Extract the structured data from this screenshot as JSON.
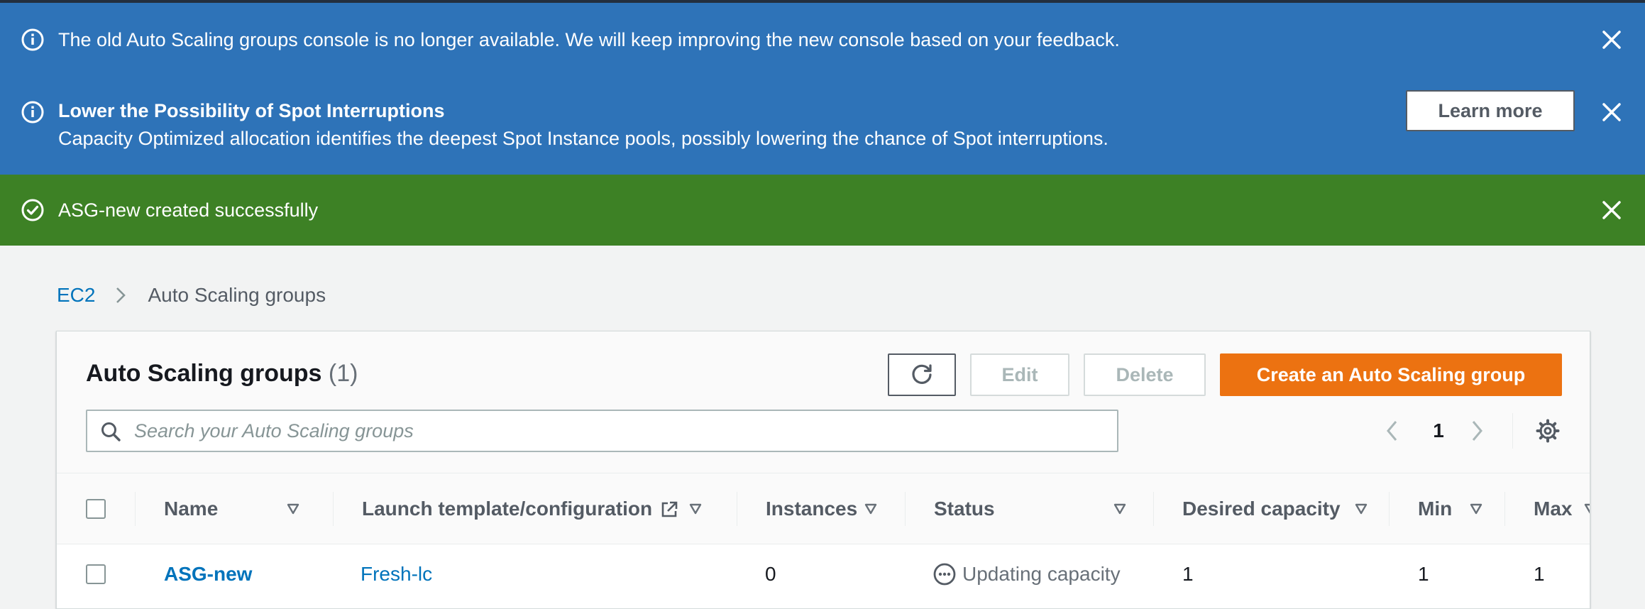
{
  "flashbar": {
    "notice_old_console": "The old Auto Scaling groups console is no longer available. We will keep improving the new console based on your feedback.",
    "spot_title": "Lower the Possibility of Spot Interruptions",
    "spot_body": "Capacity Optimized allocation identifies the deepest Spot Instance pools, possibly lowering the chance of Spot interruptions.",
    "spot_button": "Learn more",
    "success_message": "ASG-new created successfully"
  },
  "breadcrumb": {
    "root": "EC2",
    "current": "Auto Scaling groups"
  },
  "panel": {
    "title": "Auto Scaling groups",
    "count": "(1)",
    "buttons": {
      "edit": "Edit",
      "delete": "Delete",
      "create": "Create an Auto Scaling group"
    },
    "search_placeholder": "Search your Auto Scaling groups",
    "page": "1"
  },
  "table": {
    "columns": {
      "name": "Name",
      "launch": "Launch template/configuration",
      "instances": "Instances",
      "status": "Status",
      "desired": "Desired capacity",
      "min": "Min",
      "max": "Max"
    },
    "rows": [
      {
        "name": "ASG-new",
        "launch": "Fresh-lc",
        "instances": "0",
        "status": "Updating capacity",
        "desired": "1",
        "min": "1",
        "max": "1"
      }
    ]
  },
  "colors": {
    "info_flash": "#2e73b8",
    "success_flash": "#3d8125",
    "primary_button": "#ec7211",
    "link": "#0073bb"
  },
  "icons": {
    "info": "info-icon",
    "success": "check-circle-icon",
    "close": "close-icon",
    "refresh": "refresh-icon",
    "search": "search-icon",
    "settings": "gear-icon",
    "external": "external-link-icon",
    "status": "ellipsis-circle-icon"
  }
}
